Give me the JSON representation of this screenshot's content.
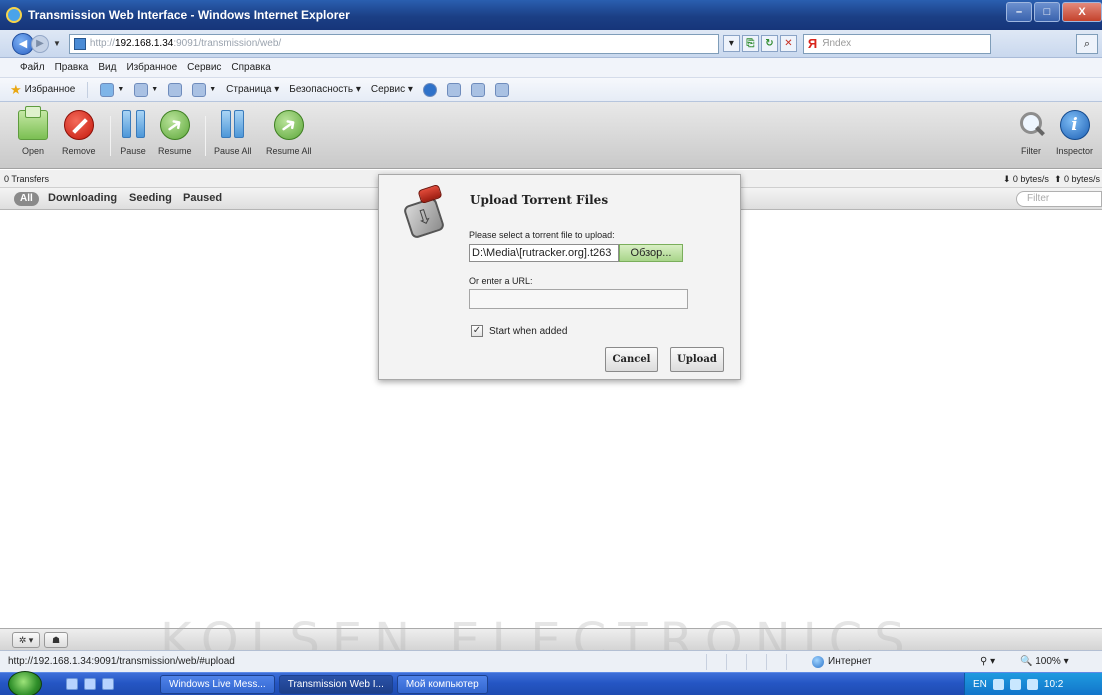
{
  "window": {
    "title": "Transmission Web Interface - Windows Internet Explorer",
    "min": "–",
    "max": "□",
    "close": "X"
  },
  "address": {
    "scheme": "http://",
    "host": "192.168.1.34",
    "rest": ":9091/transmission/web/"
  },
  "search": {
    "placeholder": "Яndex",
    "logo": "Я"
  },
  "menu": [
    "Файл",
    "Правка",
    "Вид",
    "Избранное",
    "Сервис",
    "Справка"
  ],
  "favorites": {
    "label": "Избранное",
    "page": "Страница ▾",
    "security": "Безопасность ▾",
    "service": "Сервис ▾"
  },
  "toolbar": {
    "open": "Open",
    "remove": "Remove",
    "pause": "Pause",
    "resume": "Resume",
    "pause_all": "Pause All",
    "resume_all": "Resume All",
    "filter": "Filter",
    "inspector": "Inspector"
  },
  "status": {
    "transfers": "0 Transfers",
    "down": "⬇ 0 bytes/s",
    "up": "⬆ 0 bytes/s"
  },
  "filters": {
    "all": "All",
    "downloading": "Downloading",
    "seeding": "Seeding",
    "paused": "Paused",
    "search_placeholder": "Filter"
  },
  "dialog": {
    "title": "Upload Torrent Files",
    "file_prompt": "Please select a torrent file to upload:",
    "file_value": "D:\\Media\\[rutracker.org].t263",
    "browse": "Обзор...",
    "url_prompt": "Or enter a URL:",
    "url_value": "",
    "start_when_added": "Start when added",
    "start_checked": true,
    "cancel": "Cancel",
    "upload": "Upload"
  },
  "watermark": "KOLSEN ELECTRONICS",
  "iestatus": {
    "url": "http://192.168.1.34:9091/transmission/web/#upload",
    "zone": "Интернет",
    "zoom": "100%"
  },
  "taskbar": {
    "tasks": [
      "Windows Live Mess...",
      "Transmission Web I...",
      "Мой компьютер"
    ],
    "lang": "EN",
    "time": "10:2"
  },
  "colors": {
    "accent": "#2556c4",
    "title_bar": "#1b3f85",
    "browse_button": "#a8d58a"
  }
}
